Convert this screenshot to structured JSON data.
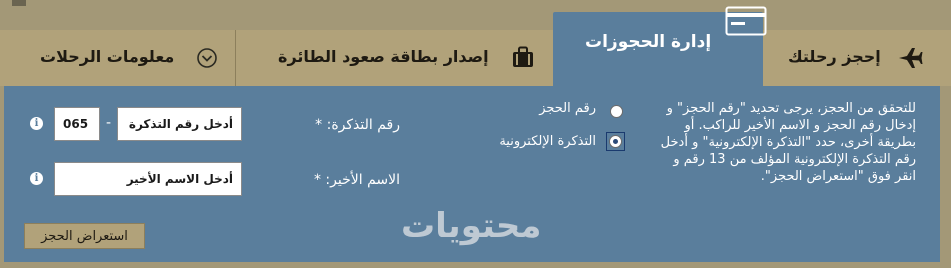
{
  "tabs": {
    "book": {
      "label": "إحجز رحلتك"
    },
    "manage": {
      "label": "إدارة الحجوزات"
    },
    "boarding": {
      "label": "إصدار بطاقة صعود الطائرة"
    },
    "info": {
      "label": "معلومات الرحلات"
    }
  },
  "instructions": "للتحقق من الحجز، يرجى تحديد \"رقم الحجز\" و إدخال رقم الحجز و الاسم الأخير للراكب. أو بطريقة أخرى، حدد \"التذكرة الإلكترونية\" و أدخل رقم التذكرة الإلكترونية المؤلف من 13 رقم و انقر فوق \"استعراض الحجز\".",
  "options": {
    "booking_number": "رقم الحجز",
    "eticket": "التذكرة الإلكترونية",
    "selected": "eticket"
  },
  "fields": {
    "ticket_label": "رقم التذكرة: *",
    "ticket_prefix": "065",
    "ticket_placeholder": "أدخل رقم التذكرة",
    "lastname_label": "الاسم الأخير: *",
    "lastname_placeholder": "أدخل الاسم الأخير"
  },
  "button": {
    "view_booking": "استعراض الحجز"
  },
  "watermark": "محتويات",
  "colors": {
    "panel": "#5a7e9c",
    "tabs": "#b1a27a",
    "page": "#a39877"
  }
}
